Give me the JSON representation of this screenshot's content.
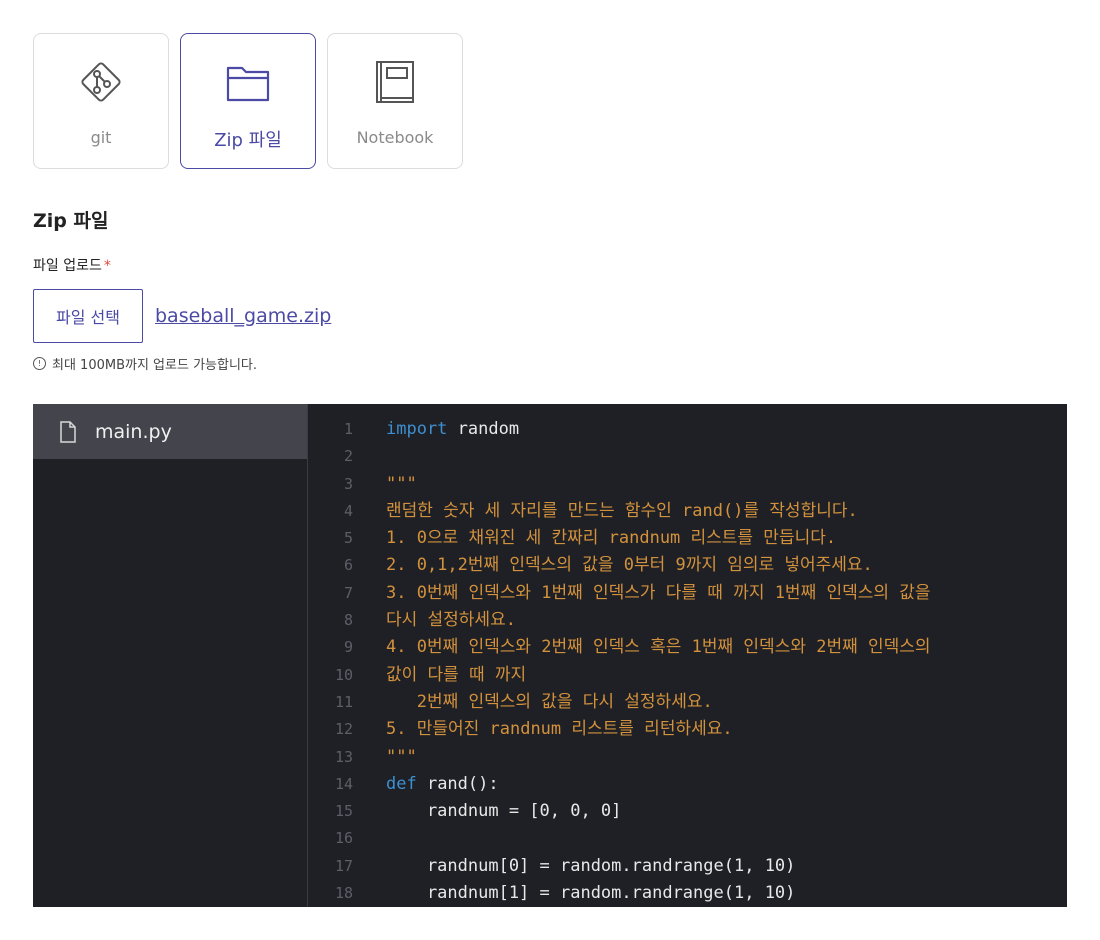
{
  "source_cards": [
    {
      "id": "git",
      "label": "git",
      "icon": "git-icon",
      "selected": false
    },
    {
      "id": "zip",
      "label": "Zip 파일",
      "icon": "folder-icon",
      "selected": true
    },
    {
      "id": "notebook",
      "label": "Notebook",
      "icon": "notebook-icon",
      "selected": false
    }
  ],
  "section_title": "Zip 파일",
  "upload": {
    "label": "파일 업로드",
    "required_mark": "*",
    "button_label": "파일 선택",
    "file_name": "baseball_game.zip",
    "hint": "최대 100MB까지 업로드 가능합니다.",
    "hint_icon": "info-icon"
  },
  "explorer": {
    "files": [
      {
        "name": "main.py",
        "icon": "file-icon",
        "active": true
      }
    ]
  },
  "code": {
    "lines": [
      {
        "n": "1",
        "tokens": [
          {
            "t": "import",
            "c": "kw"
          },
          {
            "t": " random",
            "c": "plain"
          }
        ]
      },
      {
        "n": "2",
        "tokens": []
      },
      {
        "n": "3",
        "tokens": [
          {
            "t": "\"\"\"",
            "c": "str"
          }
        ]
      },
      {
        "n": "4",
        "tokens": [
          {
            "t": "랜덤한 숫자 세 자리를 만드는 함수인 rand()를 작성합니다.",
            "c": "str"
          }
        ]
      },
      {
        "n": "5",
        "tokens": [
          {
            "t": "1. 0으로 채워진 세 칸짜리 randnum 리스트를 만듭니다.",
            "c": "str"
          }
        ]
      },
      {
        "n": "6",
        "tokens": [
          {
            "t": "2. 0,1,2번째 인덱스의 값을 0부터 9까지 임의로 넣어주세요.",
            "c": "str"
          }
        ]
      },
      {
        "n": "7",
        "tokens": [
          {
            "t": "3. 0번째 인덱스와 1번째 인덱스가 다를 때 까지 1번째 인덱스의 값을",
            "c": "str"
          }
        ]
      },
      {
        "n": "8",
        "tokens": [
          {
            "t": "다시 설정하세요.",
            "c": "str"
          }
        ]
      },
      {
        "n": "9",
        "tokens": [
          {
            "t": "4. 0번째 인덱스와 2번째 인덱스 혹은 1번째 인덱스와 2번째 인덱스의",
            "c": "str"
          }
        ]
      },
      {
        "n": "10",
        "tokens": [
          {
            "t": "값이 다를 때 까지",
            "c": "str"
          }
        ]
      },
      {
        "n": "11",
        "tokens": [
          {
            "t": "   2번째 인덱스의 값을 다시 설정하세요.",
            "c": "str"
          }
        ]
      },
      {
        "n": "12",
        "tokens": [
          {
            "t": "5. 만들어진 randnum 리스트를 리턴하세요.",
            "c": "str"
          }
        ]
      },
      {
        "n": "13",
        "tokens": [
          {
            "t": "\"\"\"",
            "c": "str"
          }
        ]
      },
      {
        "n": "14",
        "tokens": [
          {
            "t": "def",
            "c": "kw"
          },
          {
            "t": " rand():",
            "c": "plain"
          }
        ]
      },
      {
        "n": "15",
        "tokens": [
          {
            "t": "    randnum = [0, 0, 0]",
            "c": "plain"
          }
        ]
      },
      {
        "n": "16",
        "tokens": []
      },
      {
        "n": "17",
        "tokens": [
          {
            "t": "    randnum[0] = random.randrange(1, 10)",
            "c": "plain"
          }
        ]
      },
      {
        "n": "18",
        "tokens": [
          {
            "t": "    randnum[1] = random.randrange(1, 10)",
            "c": "plain"
          }
        ]
      }
    ]
  },
  "colors": {
    "accent": "#4b4aa5",
    "editor_bg": "#1f2025",
    "keyword": "#3d8fd0",
    "string": "#d2913c",
    "required": "#e0483e"
  }
}
